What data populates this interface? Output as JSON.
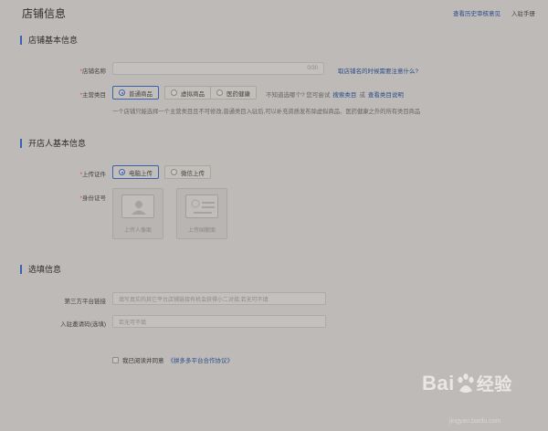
{
  "header": {
    "title": "店铺信息",
    "link_history": "查看历史审核意见",
    "link_manual": "入驻手册"
  },
  "section_basic": {
    "title": "店铺基本信息",
    "shop_name_label": "店铺名称",
    "shop_name_counter": "0/30",
    "shop_name_help": "取店铺名的时候需要注意什么?",
    "category_label": "主营类目",
    "category_options": [
      "普通商品",
      "虚拟商品",
      "医药健康"
    ],
    "category_selected": "普通商品",
    "category_hint": "不知道选哪个? 您可尝试",
    "category_search_link": "搜索类目",
    "category_or": "或",
    "category_desc_link": "查看类目说明",
    "category_note": "一个店铺只能选择一个主营类目且不可修改,普通类目入驻后,可以补充资质发布除虚拟商品、医药健康之外的所有类目商品"
  },
  "section_owner": {
    "title": "开店人基本信息",
    "upload_label": "上传证件",
    "upload_options": [
      "电脑上传",
      "微信上传"
    ],
    "upload_selected": "电脑上传",
    "id_label": "身份证号",
    "id_front": "上传人像面",
    "id_back": "上传国徽面"
  },
  "section_optional": {
    "title": "选填信息",
    "third_party_label": "第三方平台链接",
    "third_party_placeholder": "填写真实的其它平台店铺链接有机会获得小二对接,若无可不填",
    "invite_label": "入驻邀请码(选填)",
    "invite_placeholder": "若无可不填"
  },
  "agreement": {
    "prefix": "我已阅读并同意",
    "link": "《拼多多平台合作协议》"
  },
  "watermark": {
    "brand": "Bai",
    "brand_suffix": "经验",
    "url": "jingyan.baidu.com"
  }
}
